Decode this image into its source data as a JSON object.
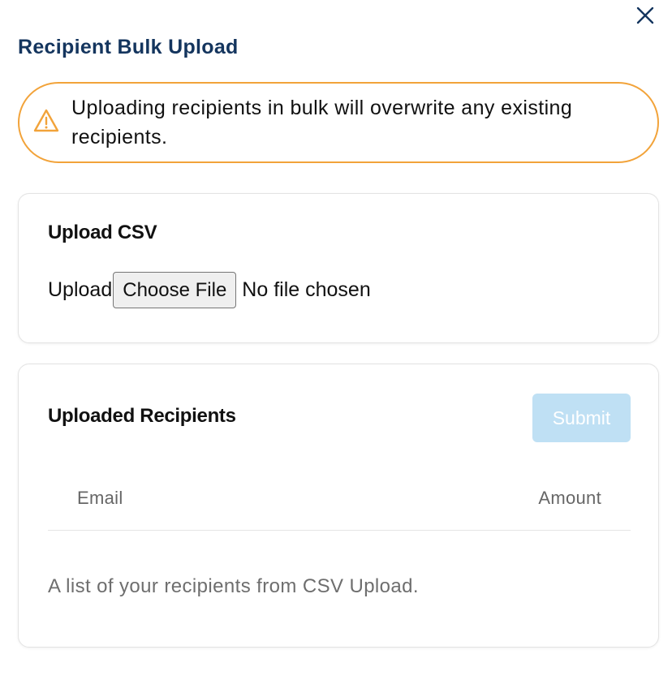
{
  "modal": {
    "title": "Recipient Bulk Upload",
    "close_icon": "close-x-icon"
  },
  "warning": {
    "icon": "warning-triangle-icon",
    "text": "Uploading recipients in bulk will overwrite any existing recipients.",
    "border_color": "#f2a33a"
  },
  "upload_card": {
    "title": "Upload CSV",
    "label": "Upload",
    "choose_file_label": "Choose File",
    "file_status": "No file chosen"
  },
  "recipients_card": {
    "title": "Uploaded Recipients",
    "submit_label": "Submit",
    "submit_disabled": true,
    "columns": [
      "Email",
      "Amount"
    ],
    "rows": [],
    "caption": "A list of your recipients from CSV Upload."
  },
  "colors": {
    "title": "#14355e",
    "warning_border": "#f2a33a",
    "submit_disabled_bg": "#bfe0f4",
    "muted_text": "#666666"
  }
}
